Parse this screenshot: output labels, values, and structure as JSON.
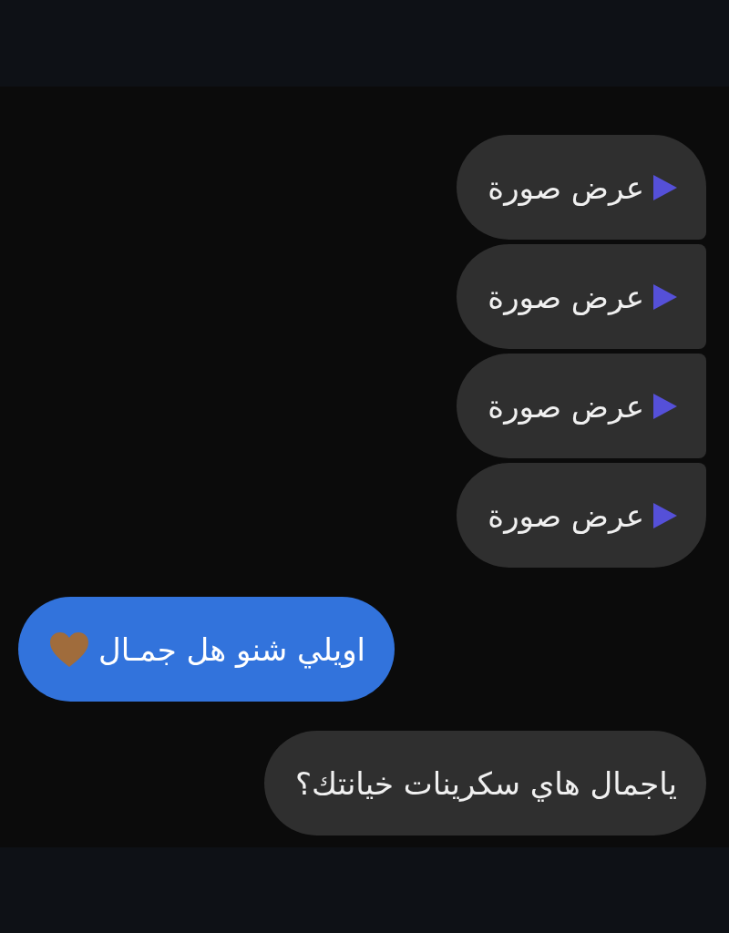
{
  "messages": [
    {
      "kind": "media",
      "outgoing": false,
      "text": "عرض صورة"
    },
    {
      "kind": "media",
      "outgoing": false,
      "text": "عرض صورة"
    },
    {
      "kind": "media",
      "outgoing": false,
      "text": "عرض صورة"
    },
    {
      "kind": "media",
      "outgoing": false,
      "text": "عرض صورة"
    },
    {
      "kind": "text",
      "outgoing": true,
      "text": "اويلي شنو هل جمـال",
      "heart": true
    },
    {
      "kind": "text",
      "outgoing": false,
      "text": "ياجمال هاي سكرينات خيانتك؟"
    }
  ]
}
